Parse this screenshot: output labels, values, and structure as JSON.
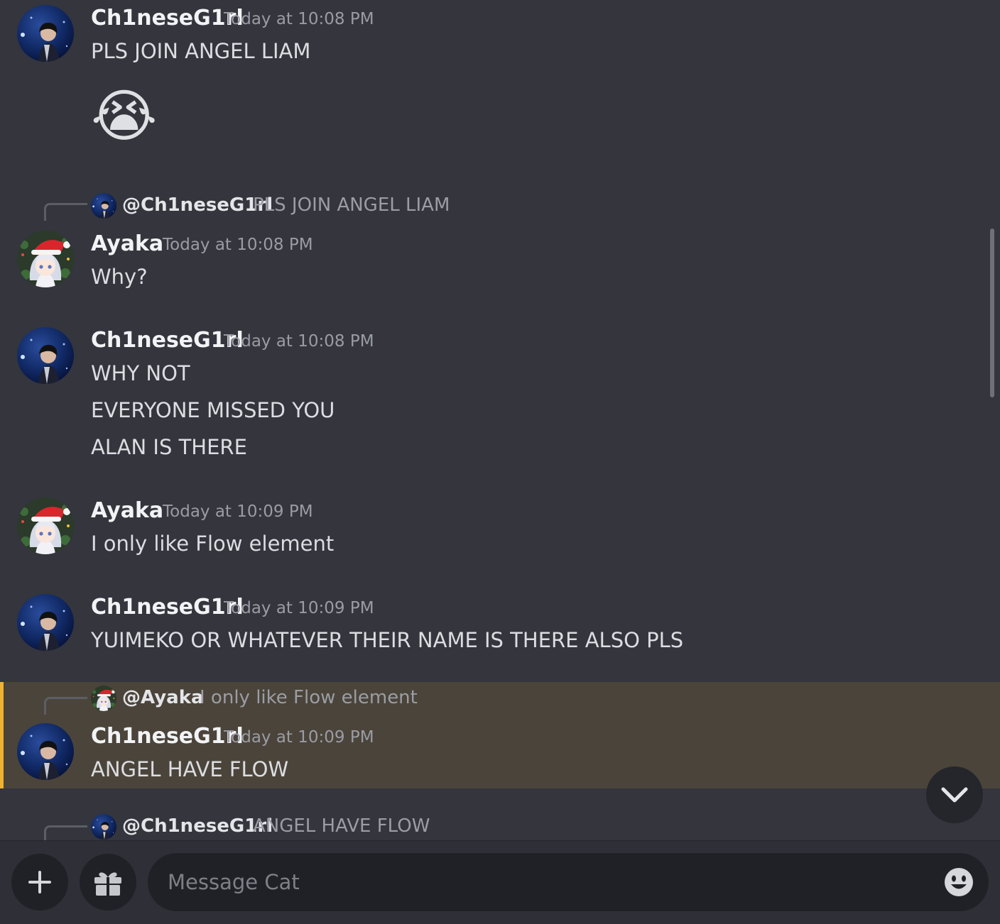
{
  "channel": {
    "input_placeholder": "Message Cat"
  },
  "messages": [
    {
      "author": "Ch1neseG1rl",
      "timestamp": "Today at 10:08 PM",
      "lines": [
        "PLS JOIN ANGEL LIAM"
      ],
      "emoji": "😭"
    },
    {
      "reply_to": {
        "mention": "@Ch1neseG1rl",
        "text": "PLS JOIN ANGEL LIAM"
      },
      "author": "Ayaka",
      "timestamp": "Today at 10:08 PM",
      "lines": [
        "Why?"
      ]
    },
    {
      "author": "Ch1neseG1rl",
      "timestamp": "Today at 10:08 PM",
      "lines": [
        "WHY NOT",
        "EVERYONE MISSED YOU",
        "ALAN IS THERE"
      ]
    },
    {
      "author": "Ayaka",
      "timestamp": "Today at 10:09 PM",
      "lines": [
        "I only like Flow element"
      ]
    },
    {
      "author": "Ch1neseG1rl",
      "timestamp": "Today at 10:09 PM",
      "lines": [
        "YUIMEKO OR WHATEVER THEIR NAME IS THERE ALSO PLS"
      ]
    },
    {
      "reply_to": {
        "mention": "@Ayaka",
        "text": "I only like Flow element"
      },
      "author": "Ch1neseG1rl",
      "timestamp": "Today at 10:09 PM",
      "lines": [
        "ANGEL HAVE FLOW"
      ],
      "highlighted": true
    },
    {
      "reply_to": {
        "mention": "@Ch1neseG1rl",
        "text": "ANGEL HAVE FLOW"
      }
    }
  ],
  "icons": {
    "add": "plus-icon",
    "gift": "gift-icon",
    "emoji_picker": "smiley-icon",
    "jump_to_present": "chevron-down-icon"
  },
  "colors": {
    "background": "#34353d",
    "mention_highlight": "#4b443a",
    "mention_bar": "#f0b232",
    "input_bg": "#202126"
  }
}
